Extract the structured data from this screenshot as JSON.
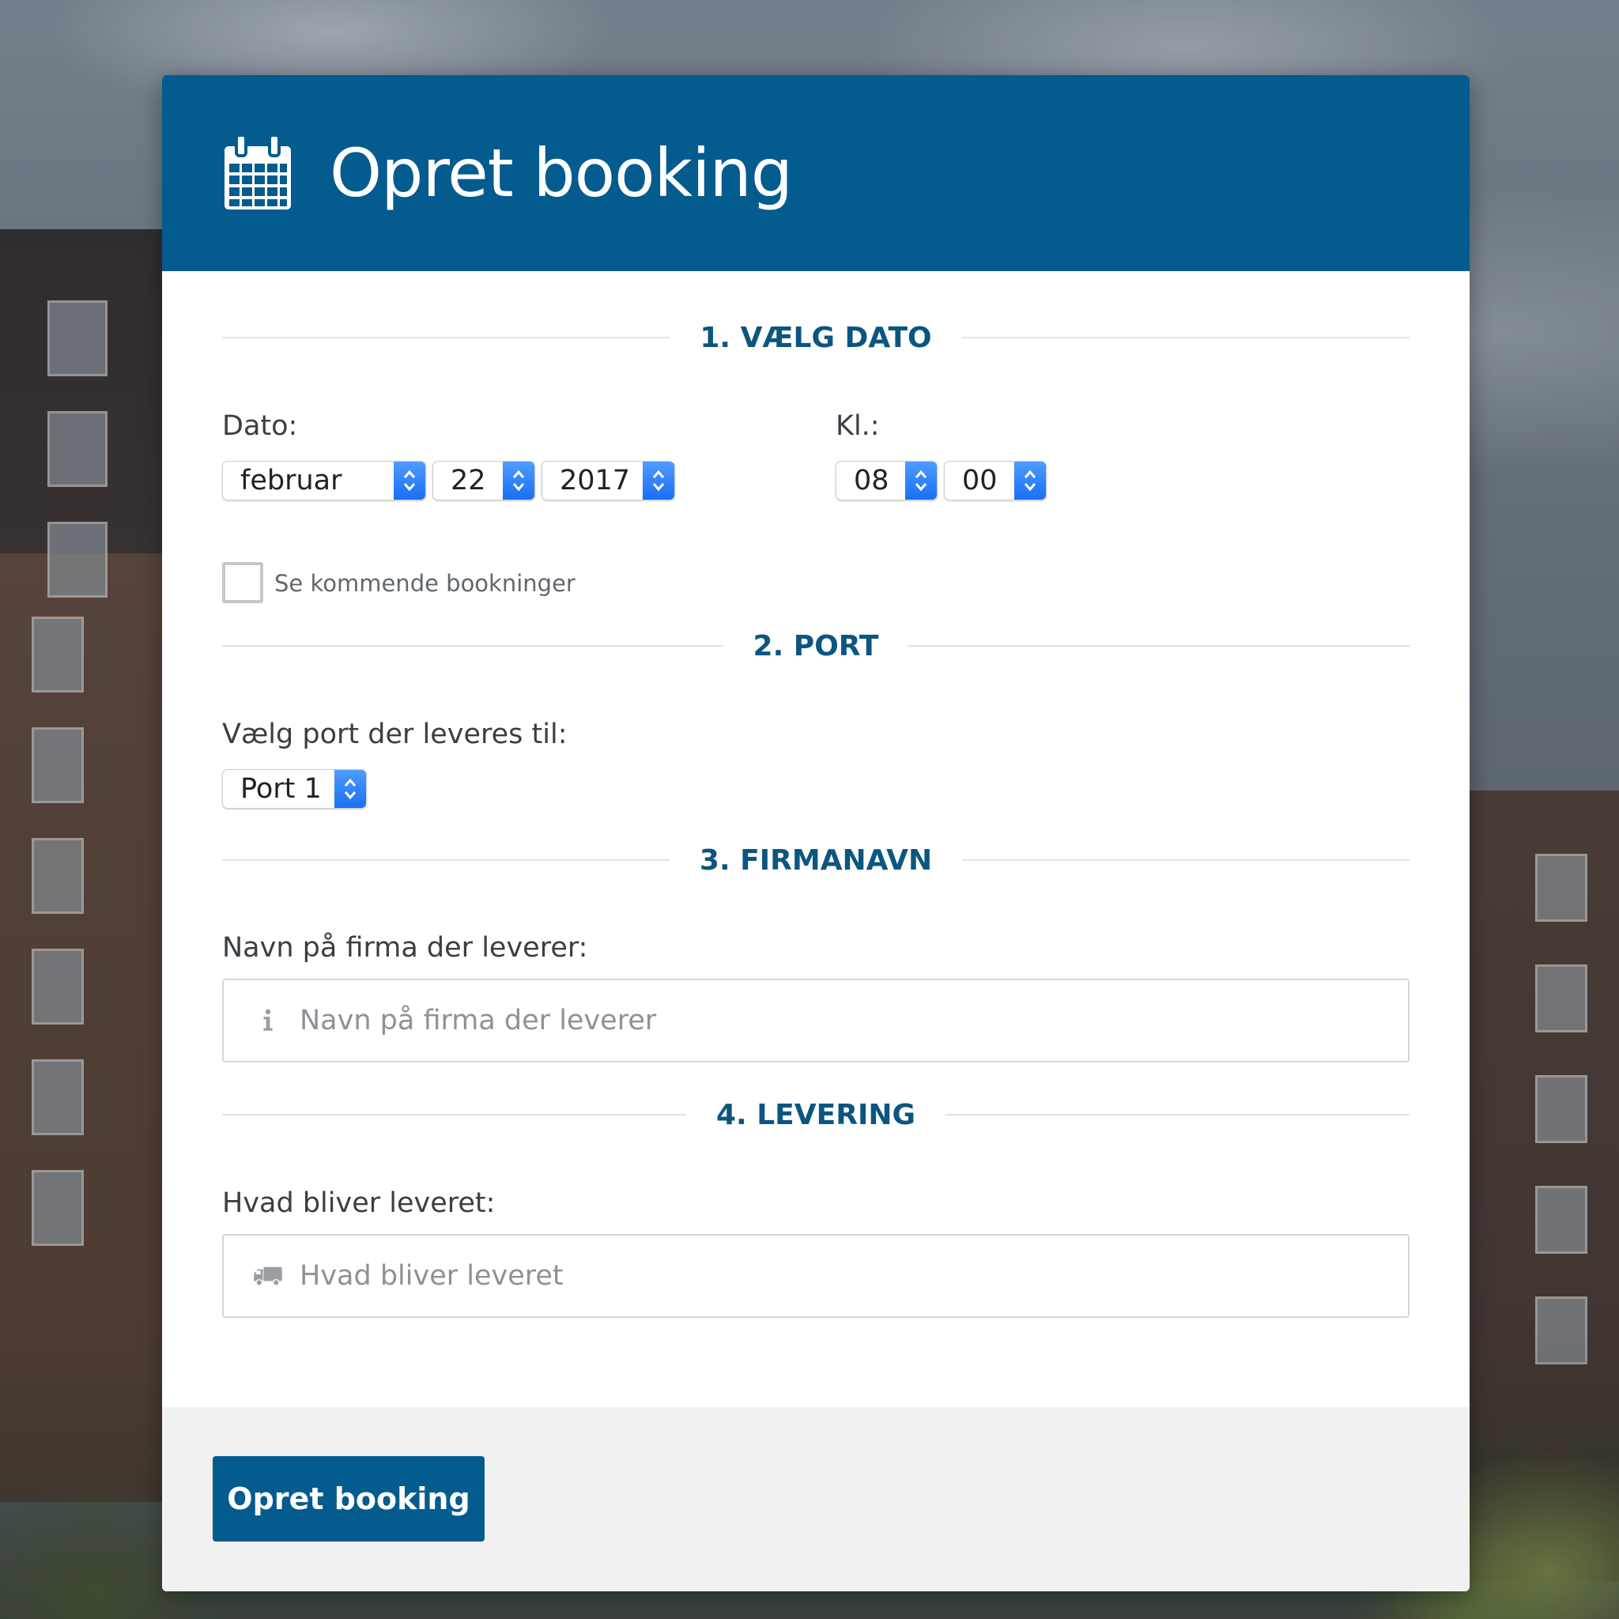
{
  "header": {
    "title": "Opret booking",
    "icon": "calendar-icon"
  },
  "colors": {
    "brand": "#045b8e",
    "section_heading": "#0b5680",
    "select_arrow": "#1a6ff5",
    "footer_bg": "#f1f1f1"
  },
  "sections": {
    "date": {
      "heading": "1. VÆLG DATO",
      "date_label": "Dato:",
      "time_label": "Kl.:",
      "month": "februar",
      "day": "22",
      "year": "2017",
      "hour": "08",
      "minute": "00",
      "checkbox_label": "Se kommende bookninger",
      "checkbox_checked": false
    },
    "port": {
      "heading": "2. PORT",
      "label": "Vælg port der leveres til:",
      "selected": "Port 1"
    },
    "company": {
      "heading": "3. FIRMANAVN",
      "label": "Navn på firma der leverer:",
      "value": "",
      "placeholder": "Navn på firma der leverer",
      "icon": "info-icon"
    },
    "delivery": {
      "heading": "4. LEVERING",
      "label": "Hvad bliver leveret:",
      "value": "",
      "placeholder": "Hvad bliver leveret",
      "icon": "truck-icon"
    }
  },
  "footer": {
    "submit_label": "Opret booking"
  }
}
